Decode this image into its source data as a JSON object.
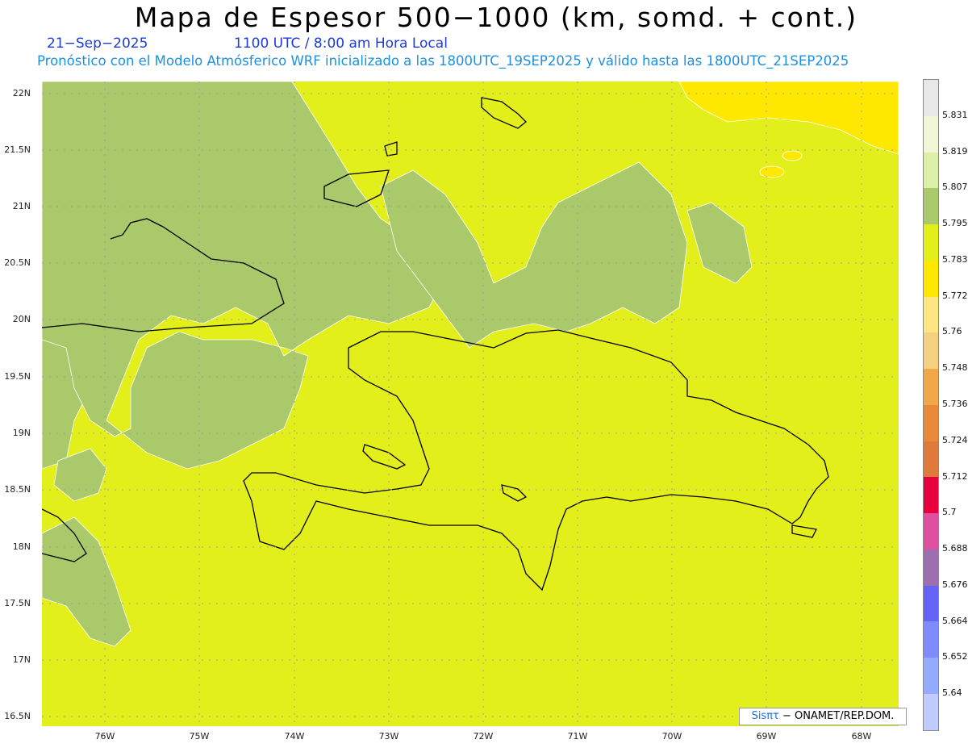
{
  "header": {
    "title": "Mapa de Espesor 500−1000 (km, somd. + cont.)",
    "date": "21−Sep−2025",
    "time": "1100 UTC / 8:00 am Hora Local",
    "model_line": "Pronóstico con el Modelo Atmósferico WRF inicializado a las 1800UTC_19SEP2025 y válido hasta las  1800UTC_21SEP2025"
  },
  "axes": {
    "lat_labels": [
      "22N",
      "21.5N",
      "21N",
      "20.5N",
      "20N",
      "19.5N",
      "19N",
      "18.5N",
      "18N",
      "17.5N",
      "17N",
      "16.5N"
    ],
    "lon_labels": [
      "76W",
      "75W",
      "74W",
      "73W",
      "72W",
      "71W",
      "70W",
      "69W",
      "68W"
    ]
  },
  "colorbar": {
    "labels": [
      "5.831",
      "5.819",
      "5.807",
      "5.795",
      "5.783",
      "5.772",
      "5.76",
      "5.748",
      "5.736",
      "5.724",
      "5.712",
      "5.7",
      "5.688",
      "5.676",
      "5.664",
      "5.652",
      "5.64"
    ],
    "colors": [
      "#e8e8e8",
      "#f2f6d8",
      "#dcf0a8",
      "#a9c96a",
      "#e3ef1a",
      "#ffe800",
      "#ffe680",
      "#f5d080",
      "#f0a848",
      "#e88a38",
      "#e07a3a",
      "#e8003c",
      "#e050a0",
      "#9c70b0",
      "#6464f8",
      "#7e8cff",
      "#94acff",
      "#c0ccff"
    ]
  },
  "credit": {
    "brand": "Sisπτ",
    "text": "− ONAMET/REP.DOM."
  },
  "palette": {
    "background_field": "#e3ef1a",
    "lower_band": "#a9c96a",
    "higher_band": "#ffe800",
    "coastline": "#000000"
  }
}
